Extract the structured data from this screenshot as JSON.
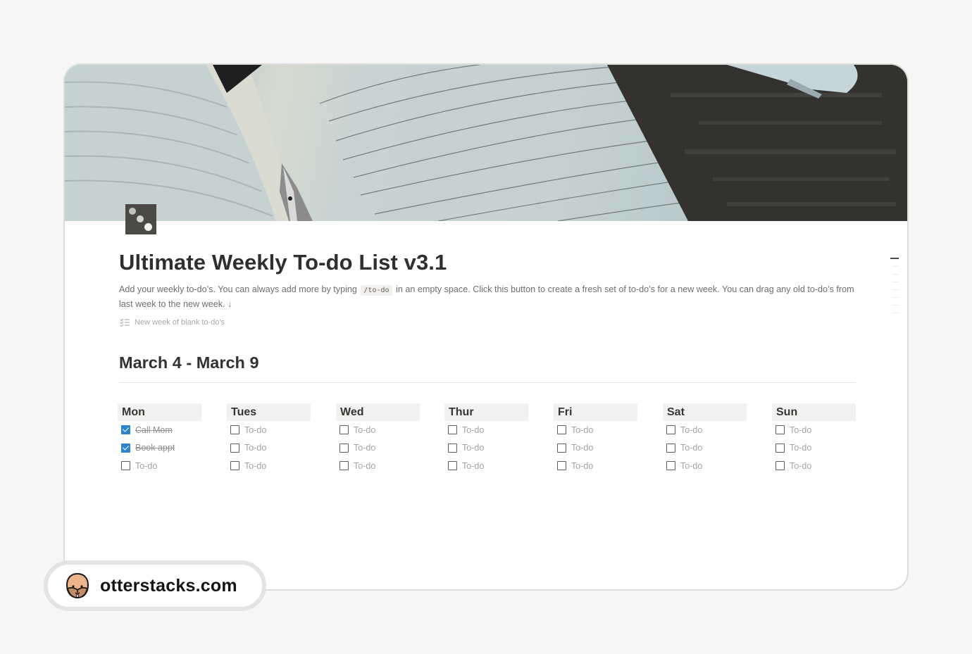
{
  "page": {
    "title": "Ultimate Weekly To-do List v3.1",
    "icon": "dice-icon",
    "description_part1": "Add your weekly to-do’s. You can always add more by typing ",
    "description_code": "/to-do",
    "description_part2": " in an empty space. Click this button to create a fresh set of to-do’s for a new week. You can drag any old to-do’s from last week to the new week. ↓",
    "template_button": "New week of blank to-do's"
  },
  "week": {
    "heading": "March 4 - March 9",
    "days": [
      {
        "label": "Mon",
        "todos": [
          {
            "text": "Call Mom",
            "checked": true
          },
          {
            "text": "Book appt",
            "checked": true
          },
          {
            "text": "To-do",
            "checked": false
          }
        ]
      },
      {
        "label": "Tues",
        "todos": [
          {
            "text": "To-do",
            "checked": false
          },
          {
            "text": "To-do",
            "checked": false
          },
          {
            "text": "To-do",
            "checked": false
          }
        ]
      },
      {
        "label": "Wed",
        "todos": [
          {
            "text": "To-do",
            "checked": false
          },
          {
            "text": "To-do",
            "checked": false
          },
          {
            "text": "To-do",
            "checked": false
          }
        ]
      },
      {
        "label": "Thur",
        "todos": [
          {
            "text": "To-do",
            "checked": false
          },
          {
            "text": "To-do",
            "checked": false
          },
          {
            "text": "To-do",
            "checked": false
          }
        ]
      },
      {
        "label": "Fri",
        "todos": [
          {
            "text": "To-do",
            "checked": false
          },
          {
            "text": "To-do",
            "checked": false
          },
          {
            "text": "To-do",
            "checked": false
          }
        ]
      },
      {
        "label": "Sat",
        "todos": [
          {
            "text": "To-do",
            "checked": false
          },
          {
            "text": "To-do",
            "checked": false
          },
          {
            "text": "To-do",
            "checked": false
          }
        ]
      },
      {
        "label": "Sun",
        "todos": [
          {
            "text": "To-do",
            "checked": false
          },
          {
            "text": "To-do",
            "checked": false
          },
          {
            "text": "To-do",
            "checked": false
          }
        ]
      }
    ]
  },
  "colors": {
    "checkbox_checked": "#2c84d0",
    "day_header_bg": "#f1f1ef"
  },
  "brand": {
    "name": "otterstacks.com",
    "logo": "otter-face-icon"
  }
}
